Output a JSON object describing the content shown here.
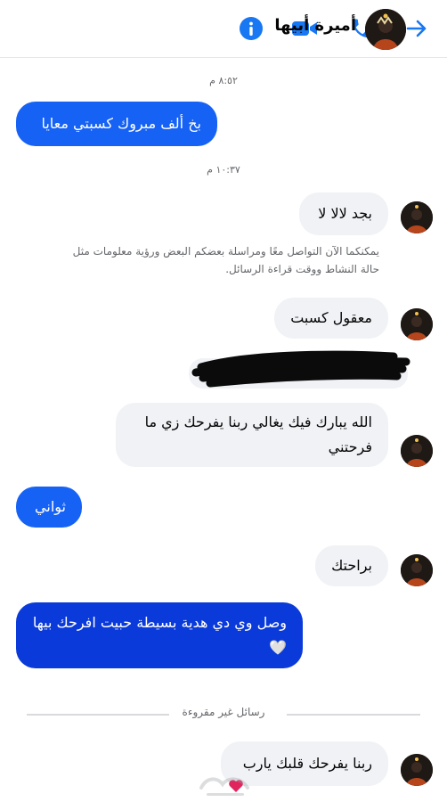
{
  "header": {
    "contact_name": "أميرة أبيها",
    "icons": [
      "back-arrow-icon",
      "phone-icon",
      "video-icon",
      "info-icon"
    ],
    "accent_color": "#1877f2"
  },
  "timestamps": [
    "٨:٥٢ م",
    "١٠:٣٧ م"
  ],
  "messages": [
    {
      "side": "out",
      "text": "بخ ألف مبروك كسبتي معايا"
    },
    {
      "side": "in",
      "text": "بجد لالا لا"
    },
    {
      "side": "in",
      "text": "معقول كسبت"
    },
    {
      "side": "in",
      "text": "الله يبارك فيك يغالي ربنا يفرحك زي ما فرحتني"
    },
    {
      "side": "out",
      "text": "ثواني"
    },
    {
      "side": "in",
      "text": "براحتك"
    },
    {
      "side": "out",
      "text": "وصل وي دي هدية بسيطة حبيت افرحك بيها 🤍"
    },
    {
      "side": "in",
      "text": "ربنا يفرحك قلبك يارب"
    }
  ],
  "notice": "يمكنكما الآن التواصل معًا ومراسلة بعضكم البعض ورؤية معلومات مثل حالة النشاط ووقت قراءة الرسائل.",
  "unread_divider": "رسائل غير مقروءة",
  "colors": {
    "outgoing_bubble": "#1662f5",
    "outgoing_bubble_dark": "#0a3ad9",
    "incoming_bubble": "#f0f2f5"
  }
}
